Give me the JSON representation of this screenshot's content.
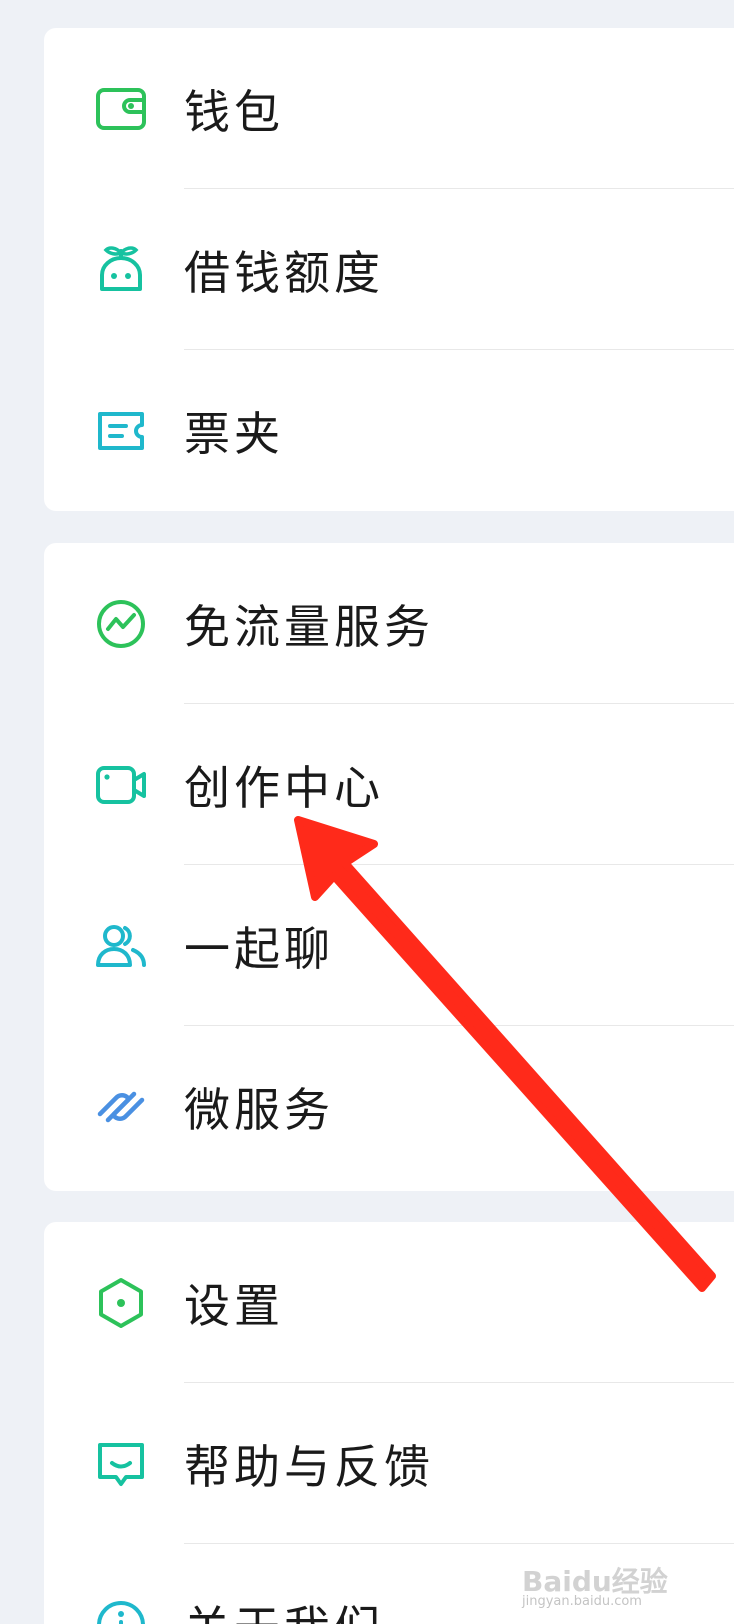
{
  "colors": {
    "background": "#eef1f6",
    "card": "#ffffff",
    "text": "#1a1a1a",
    "divider": "#e8e8e8",
    "icon_green": "#2dc25a",
    "icon_teal": "#16c2a0",
    "icon_cyan": "#1fb8cc",
    "icon_blue": "#4a90e2",
    "annotation_arrow": "#ff2a1a"
  },
  "groups": [
    {
      "items": [
        {
          "label": "钱包",
          "icon": "wallet-icon"
        },
        {
          "label": "借钱额度",
          "icon": "sprout-loan-icon"
        },
        {
          "label": "票夹",
          "icon": "ticket-icon"
        }
      ]
    },
    {
      "items": [
        {
          "label": "免流量服务",
          "icon": "data-free-icon"
        },
        {
          "label": "创作中心",
          "icon": "video-camera-icon"
        },
        {
          "label": "一起聊",
          "icon": "users-icon"
        },
        {
          "label": "微服务",
          "icon": "mini-service-icon"
        }
      ]
    },
    {
      "items": [
        {
          "label": "设置",
          "icon": "settings-hex-icon"
        },
        {
          "label": "帮助与反馈",
          "icon": "feedback-icon"
        },
        {
          "label": "关于我们",
          "icon": "info-icon"
        }
      ]
    }
  ],
  "annotation": {
    "type": "arrow",
    "target": "创作中心"
  },
  "watermark": {
    "logo": "Baidu经验",
    "sub": "jingyan.baidu.com"
  }
}
